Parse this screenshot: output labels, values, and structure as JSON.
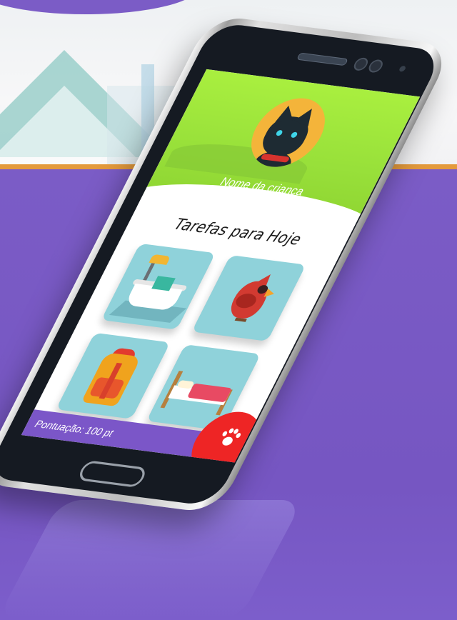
{
  "app": {
    "child_name": "Nome da criança",
    "tasks_title": "Tarefas para Hoje",
    "score_text": "Pontuação: 100 pt",
    "tasks": [
      {
        "icon": "bathtub-icon"
      },
      {
        "icon": "bird-icon"
      },
      {
        "icon": "backpack-icon"
      },
      {
        "icon": "bed-icon"
      }
    ],
    "fab_icon": "paw-icon"
  },
  "colors": {
    "background_purple": "#7b5cc6",
    "header_green": "#a9ef3f",
    "tile_teal": "#8fd2da",
    "footer_purple": "#7b56c8",
    "fab_red": "#ee2525",
    "accent_orange": "#e49a3c"
  }
}
